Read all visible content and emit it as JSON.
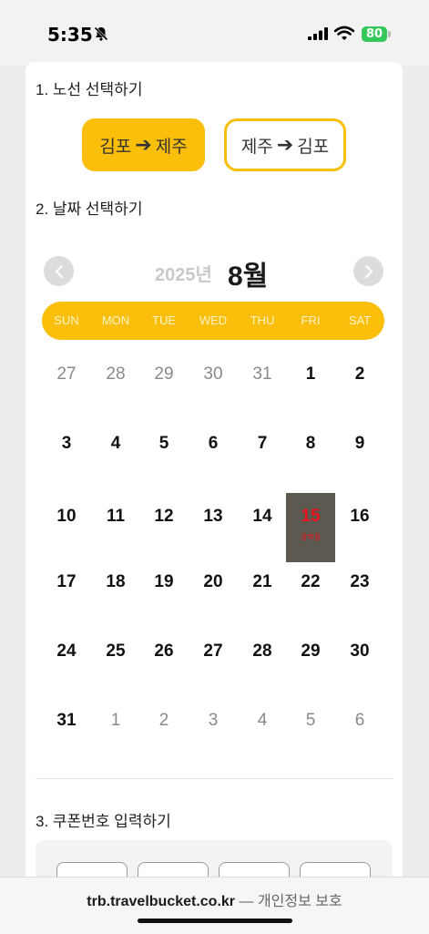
{
  "status_bar": {
    "time": "5:35",
    "battery": "80"
  },
  "sections": {
    "route_title": "1. 노선 선택하기",
    "date_title": "2. 날짜 선택하기",
    "coupon_title": "3. 쿠폰번호 입력하기"
  },
  "routes": [
    {
      "from": "김포",
      "to": "제주",
      "active": true
    },
    {
      "from": "제주",
      "to": "김포",
      "active": false
    }
  ],
  "calendar": {
    "year": "2025년",
    "month": "8월",
    "weekdays": [
      "SUN",
      "MON",
      "TUE",
      "WED",
      "THU",
      "FRI",
      "SAT"
    ],
    "weeks": [
      [
        "27",
        "28",
        "29",
        "30",
        "31",
        "1",
        "2"
      ],
      [
        "3",
        "4",
        "5",
        "6",
        "7",
        "8",
        "9"
      ],
      [
        "10",
        "11",
        "12",
        "13",
        "14",
        "15",
        "16"
      ],
      [
        "17",
        "18",
        "19",
        "20",
        "21",
        "22",
        "23"
      ],
      [
        "24",
        "25",
        "26",
        "27",
        "28",
        "29",
        "30"
      ],
      [
        "31",
        "1",
        "2",
        "3",
        "4",
        "5",
        "6"
      ]
    ],
    "selected_day": "15",
    "selected_note": "광복절"
  },
  "browser": {
    "domain": "trb.travelbucket.co.kr",
    "separator": "—",
    "privacy": "개인정보 보호"
  },
  "colors": {
    "accent": "#fbbf0b",
    "selected_bg": "#5b5950",
    "holiday": "#e8101a"
  }
}
